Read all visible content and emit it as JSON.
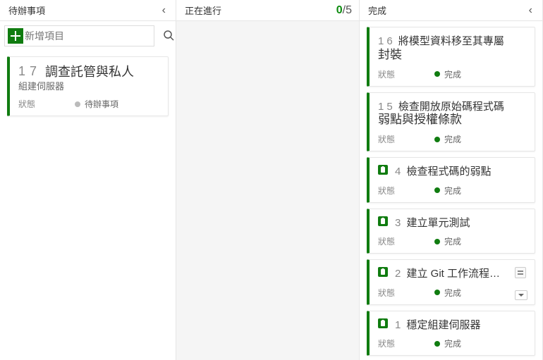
{
  "columns": {
    "backlog": {
      "title": "待辦事項"
    },
    "wip": {
      "title": "正在進行",
      "current": "0",
      "max": "5"
    },
    "done": {
      "title": "完成"
    }
  },
  "newItem": {
    "placeholder": "新增項目"
  },
  "stateLabel": "狀態",
  "stateValues": {
    "backlog": "待辦事項",
    "done": "完成"
  },
  "backlogCards": [
    {
      "num": "17",
      "title": "調查託管與私人",
      "sub": "組建伺服器"
    }
  ],
  "doneCards": [
    {
      "num": "16",
      "title": "將模型資料移至其專屬",
      "sub": "封裝",
      "clip": false
    },
    {
      "num": "15",
      "title": "檢查開放原始碼程式碼",
      "sub": "弱點與授權條款",
      "clip": false
    },
    {
      "num": "4",
      "title": "檢查程式碼的弱點",
      "clip": true
    },
    {
      "num": "3",
      "title": "建立單元測試",
      "clip": true
    },
    {
      "num": "2",
      "title": "建立 Git 工作流程…",
      "clip": true,
      "edit": true,
      "expand": true
    },
    {
      "num": "1",
      "title": "穩定組建伺服器",
      "clip": true
    }
  ]
}
